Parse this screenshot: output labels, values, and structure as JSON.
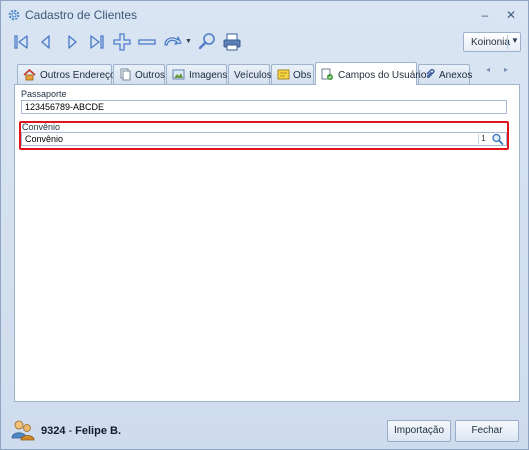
{
  "window": {
    "title": "Cadastro de Clientes",
    "minimize_glyph": "–",
    "close_glyph": "✕"
  },
  "toolbar": {
    "icons": [
      "first-icon",
      "previous-icon",
      "next-icon",
      "last-icon",
      "add-icon",
      "remove-icon",
      "undo-icon",
      "search-icon",
      "print-icon"
    ],
    "company_label": "Koinonia",
    "company_arrow": "▼"
  },
  "tabs": {
    "items": [
      {
        "label": "Outros Endereços",
        "icon": "home-icon"
      },
      {
        "label": "Outros",
        "icon": "documents-icon"
      },
      {
        "label": "Imagens",
        "icon": "picture-icon"
      },
      {
        "label": "Veículos",
        "icon": ""
      },
      {
        "label": "Obs",
        "icon": "note-icon"
      },
      {
        "label": "Campos do Usuário",
        "icon": "user-fields-icon"
      },
      {
        "label": "Anexos",
        "icon": "paperclip-icon"
      }
    ],
    "active": "Campos do Usuário",
    "nav_left": "◂",
    "nav_right": "▸"
  },
  "form": {
    "passaporte_label": "Passaporte",
    "passaporte_value": "123456789-ABCDE",
    "convenio_label": "Convênio",
    "convenio_value": "Convênio",
    "convenio_lookup_num": "1",
    "highlight_color": "#e0141d"
  },
  "footer": {
    "user_id": "9324",
    "user_sep": "-",
    "user_name": "Felipe B.",
    "import_button": "Importação",
    "close_button": "Fechar"
  }
}
